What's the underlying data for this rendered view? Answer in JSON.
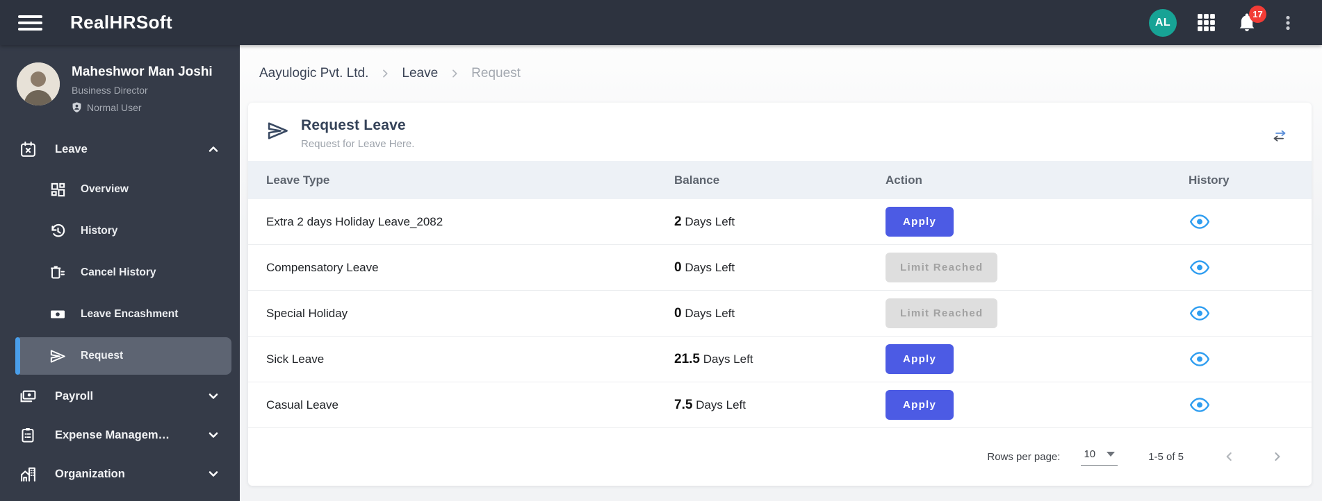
{
  "topbar": {
    "app_name": "RealHRSoft",
    "avatar_initials": "AL",
    "notification_count": "17"
  },
  "sidebar": {
    "user": {
      "name": "Maheshwor Man Joshi",
      "title": "Business Director",
      "badge": "Normal User"
    },
    "nav": {
      "leave": "Leave",
      "overview": "Overview",
      "history": "History",
      "cancel_history": "Cancel History",
      "leave_encashment": "Leave Encashment",
      "request": "Request",
      "payroll": "Payroll",
      "expense_management": "Expense Managem…",
      "organization": "Organization"
    }
  },
  "breadcrumb": {
    "company": "Aayulogic Pvt. Ltd.",
    "section": "Leave",
    "current": "Request"
  },
  "card": {
    "title": "Request Leave",
    "subtitle": "Request for Leave Here."
  },
  "table": {
    "headers": [
      "Leave Type",
      "Balance",
      "Action",
      "History"
    ],
    "days_left_suffix": "Days Left",
    "actions": {
      "apply_label": "Apply",
      "limit_label": "Limit Reached"
    },
    "rows": [
      {
        "leave_type": "Extra 2 days Holiday Leave_2082",
        "balance": "2",
        "action": "apply"
      },
      {
        "leave_type": "Compensatory Leave",
        "balance": "0",
        "action": "limit"
      },
      {
        "leave_type": "Special Holiday",
        "balance": "0",
        "action": "limit"
      },
      {
        "leave_type": "Sick Leave",
        "balance": "21.5",
        "action": "apply"
      },
      {
        "leave_type": "Casual Leave",
        "balance": "7.5",
        "action": "apply"
      }
    ]
  },
  "pagination": {
    "rows_per_page_label": "Rows per page:",
    "rows_per_page_value": "10",
    "range_label": "1-5 of 5"
  },
  "icons": {
    "topbar": [
      "hamburger-icon",
      "apps-grid-icon",
      "bell-icon",
      "kebab-menu-icon"
    ],
    "sidebar": [
      "calendar-leave-icon",
      "dashboard-icon",
      "history-clock-icon",
      "cancel-history-icon",
      "banknote-icon",
      "paper-plane-icon",
      "payroll-icon",
      "expense-clipboard-icon",
      "organization-building-icon"
    ],
    "table": [
      "eye-icon",
      "swap-arrows-icon"
    ]
  },
  "colors": {
    "topbar_bg": "#2d333f",
    "sidebar_bg": "#353b48",
    "selected_item_bg": "#5d6472",
    "accent_blue": "#4a9ee9",
    "apply_button": "#4c5be4",
    "limit_button_bg": "#dedede",
    "eye_icon": "#2e9df0",
    "avatar_teal": "#17a395",
    "badge_red": "#f23c36",
    "table_header_bg": "#edf1f6"
  }
}
